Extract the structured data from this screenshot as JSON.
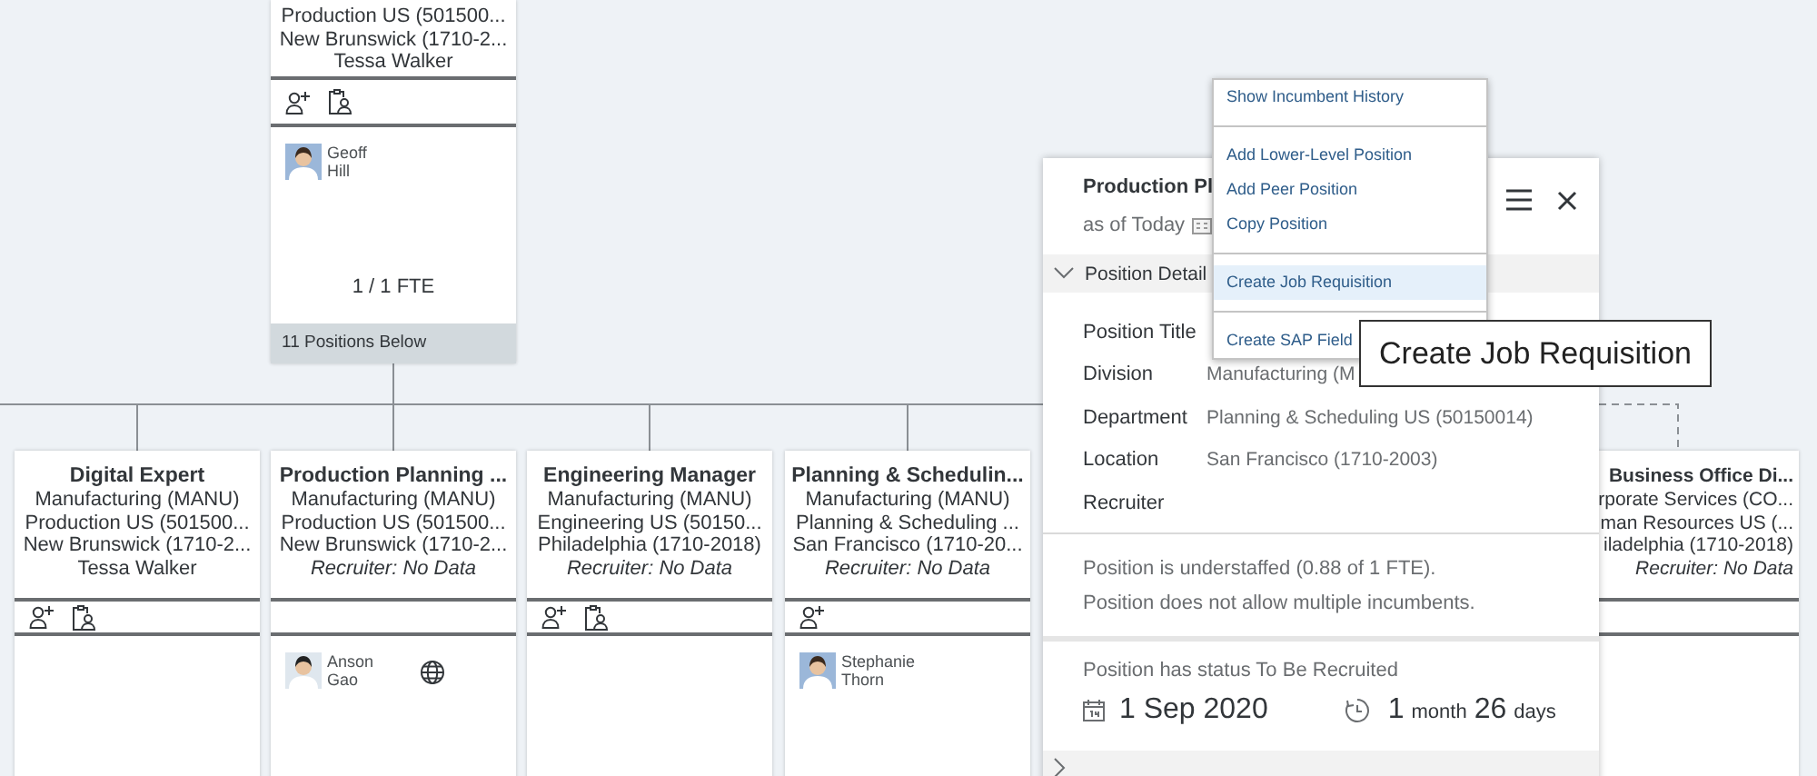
{
  "top_card": {
    "lines": [
      {
        "text": "Production US (501500...",
        "kind": "plain"
      },
      {
        "text": "New Brunswick (1710-2...",
        "kind": "plain"
      },
      {
        "text": "Tessa Walker",
        "kind": "plain"
      }
    ],
    "actions": [
      {
        "kind": "add-person"
      },
      {
        "kind": "requisition"
      }
    ],
    "incumbent": {
      "first": "Geoff",
      "last": "Hill"
    },
    "fte": "1 / 1 FTE",
    "footer": "11 Positions Below"
  },
  "cards": [
    {
      "title": "Digital Expert",
      "lines": [
        {
          "text": "Manufacturing (MANU)",
          "kind": "plain"
        },
        {
          "text": "Production US (501500...",
          "kind": "plain"
        },
        {
          "text": "New Brunswick (1710-2...",
          "kind": "plain"
        },
        {
          "text": "Tessa Walker",
          "kind": "plain"
        }
      ],
      "actions": [
        {
          "kind": "add-person"
        },
        {
          "kind": "requisition"
        }
      ]
    },
    {
      "title": "Production Planning ...",
      "lines": [
        {
          "text": "Manufacturing (MANU)",
          "kind": "plain"
        },
        {
          "text": "Production US (501500...",
          "kind": "plain"
        },
        {
          "text": "New Brunswick (1710-2...",
          "kind": "plain"
        },
        {
          "text": "Recruiter: No Data",
          "kind": "recruiter"
        }
      ],
      "incumbent": {
        "first": "Anson",
        "last": "Gao",
        "globe": true
      }
    },
    {
      "title": "Engineering Manager",
      "lines": [
        {
          "text": "Manufacturing (MANU)",
          "kind": "plain"
        },
        {
          "text": "Engineering US (50150...",
          "kind": "plain"
        },
        {
          "text": "Philadelphia (1710-2018)",
          "kind": "plain"
        },
        {
          "text": "Recruiter: No Data",
          "kind": "recruiter"
        }
      ],
      "actions": [
        {
          "kind": "add-person"
        },
        {
          "kind": "requisition"
        }
      ]
    },
    {
      "title": "Planning & Schedulin...",
      "lines": [
        {
          "text": "Manufacturing (MANU)",
          "kind": "plain"
        },
        {
          "text": "Planning & Scheduling ...",
          "kind": "plain"
        },
        {
          "text": "San Francisco (1710-20...",
          "kind": "plain"
        },
        {
          "text": "Recruiter: No Data",
          "kind": "recruiter"
        }
      ],
      "actions": [
        {
          "kind": "add-person"
        }
      ],
      "incumbent": {
        "first": "Stephanie",
        "last": "Thorn"
      }
    },
    {
      "title": "Business Office Di...",
      "lines": [
        {
          "text": "rporate Services (CO...",
          "kind": "plain"
        },
        {
          "text": "man Resources US (...",
          "kind": "plain"
        },
        {
          "text": "iladelphia (1710-2018)",
          "kind": "plain"
        },
        {
          "text": "Recruiter: No Data",
          "kind": "recruiter"
        }
      ]
    }
  ],
  "popover": {
    "title": "Production Pl",
    "subtitle": "as of Today",
    "section": {
      "label": "Position Detail",
      "expanded": true
    },
    "fields": [
      {
        "label": "Position Title"
      },
      {
        "label": "Division",
        "value": "Manufacturing (M"
      },
      {
        "label": "Department",
        "value": "Planning & Scheduling US (50150014)"
      },
      {
        "label": "Location",
        "value": "San Francisco (1710-2003)"
      },
      {
        "label": "Recruiter"
      }
    ],
    "notes": [
      "Position is understaffed (0.88 of 1 FTE).",
      "Position does not allow multiple incumbents."
    ],
    "status": "Position has status To Be Recruited",
    "date": "1 Sep 2020",
    "duration": [
      {
        "value": "1",
        "unit": "month"
      },
      {
        "value": "26",
        "unit": "days"
      }
    ],
    "next_section": {
      "expanded": false
    }
  },
  "menu": {
    "groups": [
      [
        {
          "label": "Show Incumbent History",
          "selected": false
        }
      ],
      [
        {
          "label": "Add Lower-Level Position",
          "selected": false
        },
        {
          "label": "Add Peer Position",
          "selected": false
        },
        {
          "label": "Copy Position",
          "selected": false
        }
      ],
      [
        {
          "label": "Create Job Requisition",
          "selected": true
        }
      ],
      [
        {
          "label": "Create SAP Field",
          "selected": false
        }
      ]
    ]
  },
  "tooltip": {
    "text": "Create Job Requisition"
  }
}
